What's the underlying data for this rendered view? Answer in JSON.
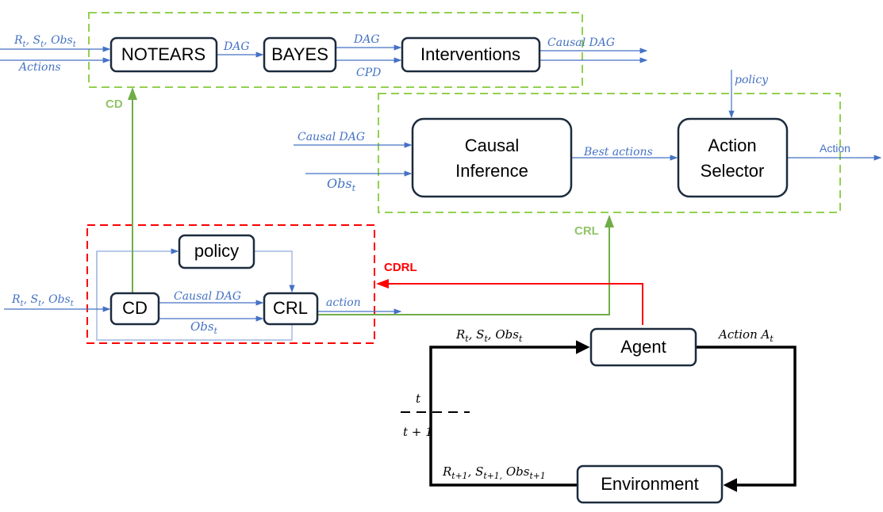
{
  "colors": {
    "flow": "#4472c4",
    "cd_group": "#92d050",
    "cdrl_group": "#ff0000",
    "loop": "#000000"
  },
  "nodes": {
    "notears": "NOTEARS",
    "bayes": "BAYES",
    "interventions": "Interventions",
    "causal_inference_1": "Causal",
    "causal_inference_2": "Inference",
    "action_selector_1": "Action",
    "action_selector_2": "Selector",
    "policy": "policy",
    "cd": "CD",
    "crl": "CRL",
    "agent": "Agent",
    "environment": "Environment"
  },
  "groups": {
    "cd": "CD",
    "crl": "CRL",
    "cdrl": "CDRL"
  },
  "labels": {
    "in_rso_top": [
      [
        "R",
        "t"
      ],
      [
        ", S",
        "t"
      ],
      [
        ", Obs",
        "t"
      ]
    ],
    "actions": "Actions",
    "dag1": "DAG",
    "dag2": "DAG",
    "cpd": "CPD",
    "causal_dag_out": "Causal DAG",
    "policy_in": "policy",
    "causal_dag_in": "Causal DAG",
    "obs_in": [
      [
        "Obs",
        "t"
      ]
    ],
    "best_actions": "Best actions",
    "action_out": "Action",
    "in_rso_left": [
      [
        "R",
        "t"
      ],
      [
        ", S",
        "t"
      ],
      [
        ", Obs",
        "t"
      ]
    ],
    "causal_dag_cd": "Causal DAG",
    "obs_cd": [
      [
        "Obs",
        "t"
      ]
    ],
    "action_crl": "action",
    "agent_in": [
      [
        "R",
        "t"
      ],
      [
        ", S",
        "t"
      ],
      [
        ", Obs",
        "t"
      ]
    ],
    "agent_out": [
      [
        "Action A",
        "t"
      ]
    ],
    "env_out": [
      [
        "R",
        "t+1"
      ],
      [
        ", S",
        "t+1,"
      ],
      [
        " Obs",
        "t+1"
      ]
    ],
    "t": "t",
    "t1": "t + 1"
  }
}
